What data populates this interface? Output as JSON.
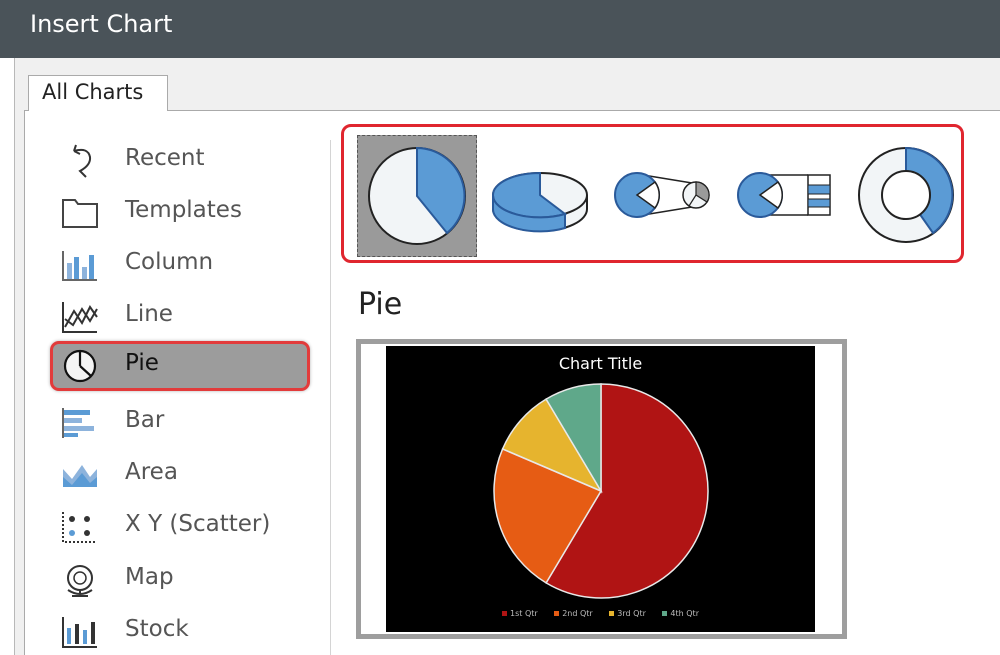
{
  "window": {
    "title": "Insert Chart"
  },
  "tabs": [
    {
      "label": "All Charts"
    }
  ],
  "categories": [
    {
      "label": "Recent",
      "icon": "recent-icon"
    },
    {
      "label": "Templates",
      "icon": "folder-icon"
    },
    {
      "label": "Column",
      "icon": "column-chart-icon"
    },
    {
      "label": "Line",
      "icon": "line-chart-icon"
    },
    {
      "label": "Pie",
      "icon": "pie-chart-icon",
      "selected": true
    },
    {
      "label": "Bar",
      "icon": "bar-chart-icon"
    },
    {
      "label": "Area",
      "icon": "area-chart-icon"
    },
    {
      "label": "X Y (Scatter)",
      "icon": "scatter-chart-icon"
    },
    {
      "label": "Map",
      "icon": "globe-icon"
    },
    {
      "label": "Stock",
      "icon": "stock-chart-icon"
    }
  ],
  "subtypes": [
    {
      "icon": "pie-icon",
      "selected": true
    },
    {
      "icon": "pie-3d-icon"
    },
    {
      "icon": "pie-of-pie-icon"
    },
    {
      "icon": "bar-of-pie-icon"
    },
    {
      "icon": "doughnut-icon"
    }
  ],
  "preview": {
    "heading": "Pie",
    "chart_title": "Chart Title",
    "legend": [
      "1st Qtr",
      "2nd Qtr",
      "3rd Qtr",
      "4th Qtr"
    ]
  },
  "chart_data": {
    "type": "pie",
    "title": "Chart Title",
    "categories": [
      "1st Qtr",
      "2nd Qtr",
      "3rd Qtr",
      "4th Qtr"
    ],
    "values": [
      8.2,
      3.2,
      1.4,
      1.2
    ],
    "colors": [
      "#b01414",
      "#e65c14",
      "#e6b42e",
      "#5fa88a"
    ],
    "legend": "bottom"
  },
  "colors": {
    "accent_selection": "#e0262f",
    "chart_icon_blue": "#5b9bd5",
    "titlebar": "#4a5359"
  }
}
